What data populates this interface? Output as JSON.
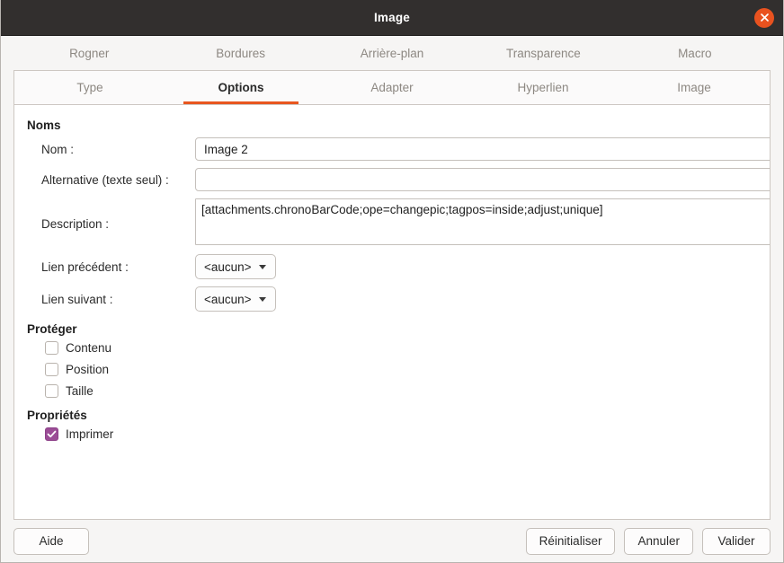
{
  "window": {
    "title": "Image",
    "close_icon": "close-icon",
    "accent_orange": "#e8561f",
    "titlebar_bg": "#322f2e",
    "check_purple": "#9b4d96"
  },
  "tabs_row1": [
    {
      "label": "Rogner",
      "active": false
    },
    {
      "label": "Bordures",
      "active": false
    },
    {
      "label": "Arrière-plan",
      "active": false
    },
    {
      "label": "Transparence",
      "active": false
    },
    {
      "label": "Macro",
      "active": false
    }
  ],
  "tabs_row2": [
    {
      "label": "Type",
      "active": false
    },
    {
      "label": "Options",
      "active": true
    },
    {
      "label": "Adapter",
      "active": false
    },
    {
      "label": "Hyperlien",
      "active": false
    },
    {
      "label": "Image",
      "active": false
    }
  ],
  "sections": {
    "noms": {
      "title": "Noms",
      "nom": {
        "label": "Nom :",
        "value": "Image 2",
        "placeholder": ""
      },
      "alternative": {
        "label": "Alternative (texte seul) :",
        "value": "",
        "placeholder": ""
      },
      "description": {
        "label": "Description :",
        "value": "[attachments.chronoBarCode;ope=changepic;tagpos=inside;adjust;unique]",
        "placeholder": ""
      },
      "lien_precedent": {
        "label": "Lien précédent :",
        "value": "<aucun>"
      },
      "lien_suivant": {
        "label": "Lien suivant :",
        "value": "<aucun>"
      }
    },
    "proteger": {
      "title": "Protéger",
      "items": [
        {
          "label": "Contenu",
          "checked": false
        },
        {
          "label": "Position",
          "checked": false
        },
        {
          "label": "Taille",
          "checked": false
        }
      ]
    },
    "proprietes": {
      "title": "Propriétés",
      "items": [
        {
          "label": "Imprimer",
          "checked": true
        }
      ]
    }
  },
  "footer": {
    "help": "Aide",
    "reset": "Réinitialiser",
    "cancel": "Annuler",
    "ok": "Valider"
  }
}
